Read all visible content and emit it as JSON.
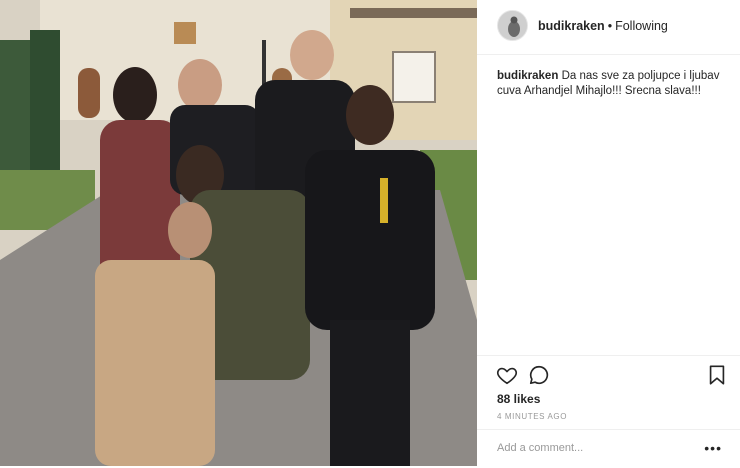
{
  "post": {
    "username": "budikraken",
    "separator": "•",
    "follow_status": "Following",
    "caption": "Da nas sve za poljupce i ljubav cuva Arhandjel Mihajlo!!! Srecna slava!!!",
    "likes": "88 likes",
    "timestamp": "4 minutes ago",
    "comment_placeholder": "Add a comment...",
    "more_options": "•••"
  },
  "icons": {
    "like": "heart-icon",
    "comment": "comment-bubble-icon",
    "save": "bookmark-icon",
    "more": "more-options-icon"
  },
  "colors": {
    "text": "#262626",
    "secondary": "#999999",
    "divider": "#efefef"
  }
}
